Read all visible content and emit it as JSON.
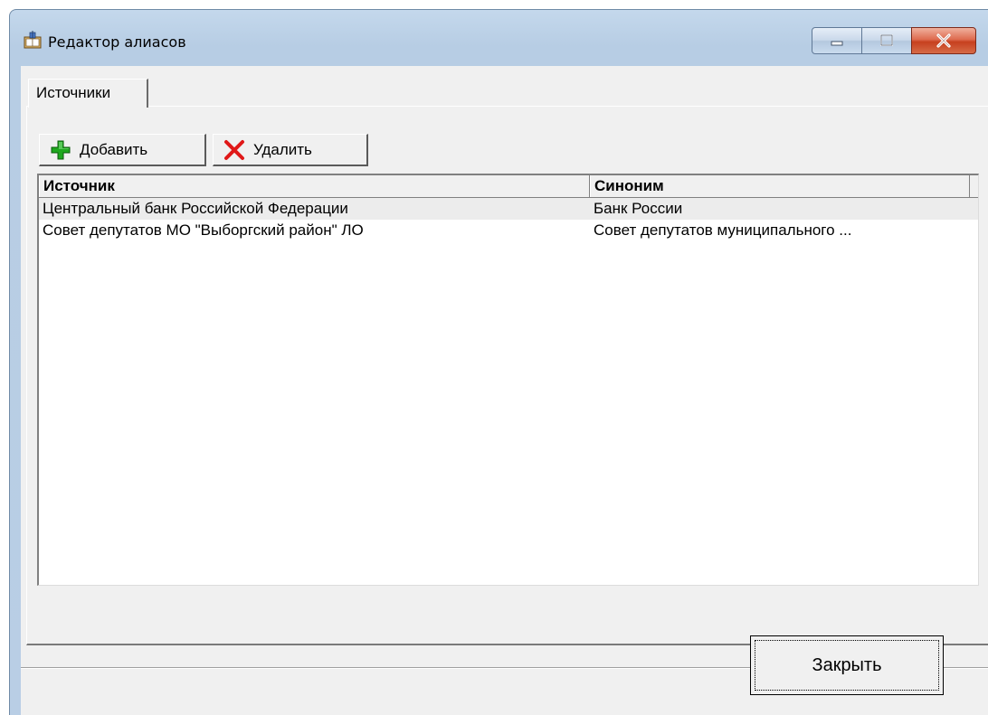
{
  "window": {
    "title": "Редактор алиасов"
  },
  "tabs": [
    {
      "label": "Источники",
      "active": true
    }
  ],
  "toolbar": {
    "add_label": "Добавить",
    "delete_label": "Удалить",
    "add_icon": "plus-icon",
    "delete_icon": "x-icon"
  },
  "table": {
    "columns": [
      "Источник",
      "Синоним"
    ],
    "rows": [
      {
        "source": "Центральный банк Российской Федерации",
        "synonym": "Банк России"
      },
      {
        "source": "Совет депутатов МО \"Выборгский район\" ЛО",
        "synonym": "Совет депутатов муниципального ..."
      }
    ]
  },
  "footer": {
    "close_label": "Закрыть"
  },
  "colors": {
    "add_icon": "#1fa81f",
    "delete_icon": "#e01818",
    "close_caption": "#c6401f"
  }
}
